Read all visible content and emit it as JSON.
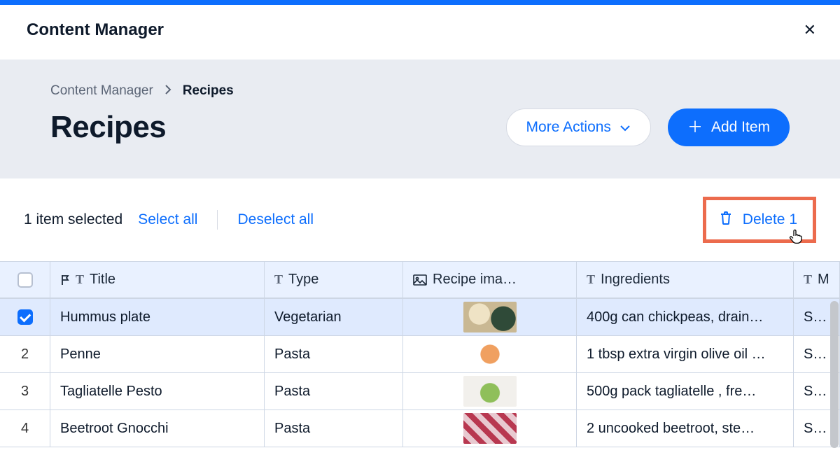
{
  "app_title": "Content Manager",
  "breadcrumb": {
    "root": "Content Manager",
    "current": "Recipes"
  },
  "page_title": "Recipes",
  "actions": {
    "more": "More Actions",
    "add": "Add Item"
  },
  "selection": {
    "count_text": "1 item selected",
    "select_all": "Select all",
    "deselect_all": "Deselect all",
    "delete_label": "Delete 1"
  },
  "columns": {
    "title": "Title",
    "type": "Type",
    "image": "Recipe ima…",
    "ingredients": "Ingredients",
    "last": "M"
  },
  "rows": [
    {
      "selected": true,
      "title": "Hummus plate",
      "type": "Vegetarian",
      "ingredients": "400g can chickpeas, drain…",
      "last": "STEF"
    },
    {
      "selected": false,
      "num": "2",
      "title": "Penne",
      "type": "Pasta",
      "ingredients": "1 tbsp extra virgin olive oil …",
      "last": "STEF"
    },
    {
      "selected": false,
      "num": "3",
      "title": "Tagliatelle Pesto",
      "type": "Pasta",
      "ingredients": "500g pack tagliatelle , fre…",
      "last": "STEF"
    },
    {
      "selected": false,
      "num": "4",
      "title": "Beetroot Gnocchi",
      "type": "Pasta",
      "ingredients": "2 uncooked beetroot, ste…",
      "last": "STEF"
    }
  ]
}
